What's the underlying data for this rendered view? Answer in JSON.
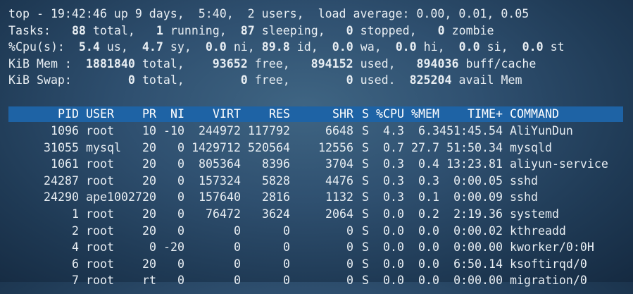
{
  "summary": {
    "line1": "top - 19:42:46 up 9 days,  5:40,  2 users,  load average: 0.00, 0.01, 0.05",
    "tasks": {
      "label": "Tasks:",
      "total": "88",
      "total_label": "total,",
      "running": "1",
      "running_label": "running,",
      "sleeping": "87",
      "sleeping_label": "sleeping,",
      "stopped": "0",
      "stopped_label": "stopped,",
      "zombie": "0",
      "zombie_label": "zombie"
    },
    "cpu": {
      "label": "%Cpu(s):",
      "us": "5.4",
      "us_label": "us,",
      "sy": "4.7",
      "sy_label": "sy,",
      "ni": "0.0",
      "ni_label": "ni,",
      "id": "89.8",
      "id_label": "id,",
      "wa": "0.0",
      "wa_label": "wa,",
      "hi": "0.0",
      "hi_label": "hi,",
      "si": "0.0",
      "si_label": "si,",
      "st": "0.0",
      "st_label": "st"
    },
    "mem": {
      "label": "KiB Mem :",
      "total": "1881840",
      "total_label": "total,",
      "free": "93652",
      "free_label": "free,",
      "used": "894152",
      "used_label": "used,",
      "buff": "894036",
      "buff_label": "buff/cache"
    },
    "swap": {
      "label": "KiB Swap:",
      "total": "0",
      "total_label": "total,",
      "free": "0",
      "free_label": "free,",
      "used": "0",
      "used_label": "used.",
      "avail": "825204",
      "avail_label": "avail Mem"
    }
  },
  "columns": {
    "pid": "PID",
    "user": "USER",
    "pr": "PR",
    "ni": "NI",
    "virt": "VIRT",
    "res": "RES",
    "shr": "SHR",
    "s": "S",
    "cpu": "%CPU",
    "mem": "%MEM",
    "time": "TIME+",
    "cmd": "COMMAND"
  },
  "processes": [
    {
      "pid": "1096",
      "user": "root",
      "pr": "10",
      "ni": "-10",
      "virt": "244972",
      "res": "117792",
      "shr": "6648",
      "s": "S",
      "cpu": "4.3",
      "mem": "6.3",
      "time": "451:45.54",
      "cmd": "AliYunDun"
    },
    {
      "pid": "31055",
      "user": "mysql",
      "pr": "20",
      "ni": "0",
      "virt": "1429712",
      "res": "520564",
      "shr": "12556",
      "s": "S",
      "cpu": "0.7",
      "mem": "27.7",
      "time": "51:50.34",
      "cmd": "mysqld"
    },
    {
      "pid": "1061",
      "user": "root",
      "pr": "20",
      "ni": "0",
      "virt": "805364",
      "res": "8396",
      "shr": "3704",
      "s": "S",
      "cpu": "0.3",
      "mem": "0.4",
      "time": "13:23.81",
      "cmd": "aliyun-service"
    },
    {
      "pid": "24287",
      "user": "root",
      "pr": "20",
      "ni": "0",
      "virt": "157324",
      "res": "5828",
      "shr": "4476",
      "s": "S",
      "cpu": "0.3",
      "mem": "0.3",
      "time": "0:00.05",
      "cmd": "sshd"
    },
    {
      "pid": "24290",
      "user": "ape10027",
      "pr": "20",
      "ni": "0",
      "virt": "157640",
      "res": "2816",
      "shr": "1132",
      "s": "S",
      "cpu": "0.3",
      "mem": "0.1",
      "time": "0:00.09",
      "cmd": "sshd"
    },
    {
      "pid": "1",
      "user": "root",
      "pr": "20",
      "ni": "0",
      "virt": "76472",
      "res": "3624",
      "shr": "2064",
      "s": "S",
      "cpu": "0.0",
      "mem": "0.2",
      "time": "2:19.36",
      "cmd": "systemd"
    },
    {
      "pid": "2",
      "user": "root",
      "pr": "20",
      "ni": "0",
      "virt": "0",
      "res": "0",
      "shr": "0",
      "s": "S",
      "cpu": "0.0",
      "mem": "0.0",
      "time": "0:00.02",
      "cmd": "kthreadd"
    },
    {
      "pid": "4",
      "user": "root",
      "pr": "0",
      "ni": "-20",
      "virt": "0",
      "res": "0",
      "shr": "0",
      "s": "S",
      "cpu": "0.0",
      "mem": "0.0",
      "time": "0:00.00",
      "cmd": "kworker/0:0H"
    },
    {
      "pid": "6",
      "user": "root",
      "pr": "20",
      "ni": "0",
      "virt": "0",
      "res": "0",
      "shr": "0",
      "s": "S",
      "cpu": "0.0",
      "mem": "0.0",
      "time": "6:50.14",
      "cmd": "ksoftirqd/0"
    },
    {
      "pid": "7",
      "user": "root",
      "pr": "rt",
      "ni": "0",
      "virt": "0",
      "res": "0",
      "shr": "0",
      "s": "S",
      "cpu": "0.0",
      "mem": "0.0",
      "time": "0:00.00",
      "cmd": "migration/0"
    }
  ],
  "colors": {
    "background": "#2f5070",
    "header_bar": "#1e63a5",
    "text": "#e8eef3"
  }
}
